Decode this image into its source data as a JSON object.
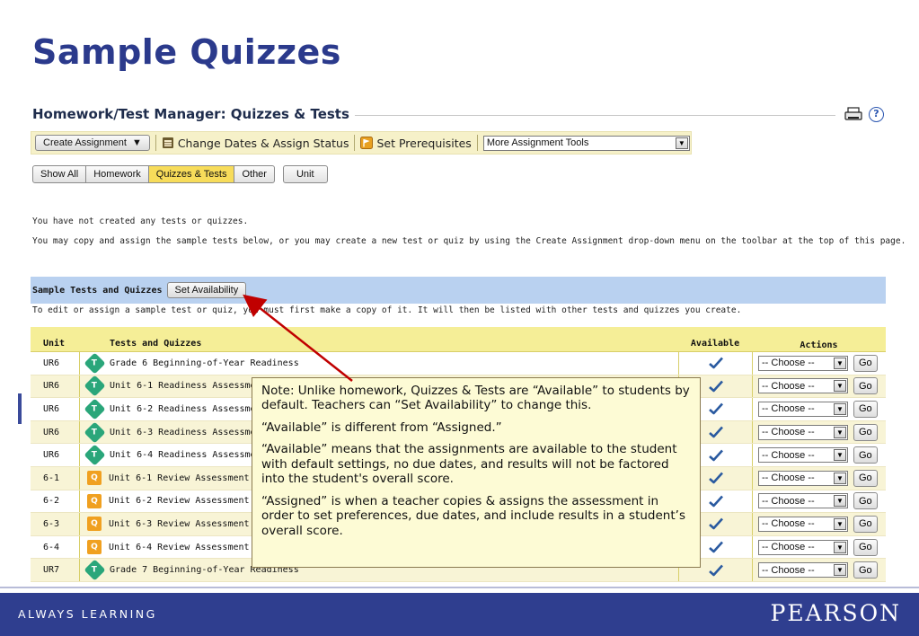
{
  "slide": {
    "title": "Sample Quizzes",
    "footer_left": "ALWAYS LEARNING",
    "footer_right": "PEARSON"
  },
  "manager": {
    "title": "Homework/Test Manager: Quizzes & Tests",
    "help_label": "?"
  },
  "toolbar": {
    "create_assignment": "Create Assignment",
    "change_dates": "Change Dates & Assign Status",
    "set_prerequisites": "Set Prerequisites",
    "more_tools": "More Assignment Tools"
  },
  "filter_tabs": [
    {
      "label": "Show All",
      "active": false
    },
    {
      "label": "Homework",
      "active": false
    },
    {
      "label": "Quizzes & Tests",
      "active": true
    },
    {
      "label": "Other",
      "active": false
    },
    {
      "label": "Unit",
      "active": false
    }
  ],
  "messages": {
    "none_created": "You have not created any tests or quizzes.",
    "may_copy": "You may copy and assign the sample tests below, or you may create a new test or quiz by using the Create Assignment drop-down menu on the toolbar at the top of this page."
  },
  "sample_section": {
    "label": "Sample Tests and Quizzes",
    "set_availability": "Set Availability",
    "instructions": "To edit or assign a sample test or quiz, you must first make a copy of it. It will then be listed with other tests and quizzes you create."
  },
  "table": {
    "headers": {
      "unit": "Unit",
      "name": "Tests and Quizzes",
      "available": "Available",
      "actions": "Actions"
    },
    "choose_label": "-- Choose --",
    "go_label": "Go",
    "rows": [
      {
        "unit": "UR6",
        "type": "T",
        "name": "Grade 6 Beginning-of-Year Readiness"
      },
      {
        "unit": "UR6",
        "type": "T",
        "name": "Unit 6-1 Readiness Assessment"
      },
      {
        "unit": "UR6",
        "type": "T",
        "name": "Unit 6-2 Readiness Assessment"
      },
      {
        "unit": "UR6",
        "type": "T",
        "name": "Unit 6-3 Readiness Assessment"
      },
      {
        "unit": "UR6",
        "type": "T",
        "name": "Unit 6-4 Readiness Assessment"
      },
      {
        "unit": "6-1",
        "type": "Q",
        "name": "Unit 6-1 Review Assessment"
      },
      {
        "unit": "6-2",
        "type": "Q",
        "name": "Unit 6-2 Review Assessment"
      },
      {
        "unit": "6-3",
        "type": "Q",
        "name": "Unit 6-3 Review Assessment"
      },
      {
        "unit": "6-4",
        "type": "Q",
        "name": "Unit 6-4 Review Assessment"
      },
      {
        "unit": "UR7",
        "type": "T",
        "name": "Grade 7 Beginning-of-Year Readiness"
      }
    ]
  },
  "callout": {
    "p1": "Note: Unlike homework, Quizzes & Tests are “Available” to students by default. Teachers can “Set Availability” to change this.",
    "p2": "“Available” is different from “Assigned.”",
    "p3": "“Available” means that the assignments are available to the student with default settings, no due dates, and results will not be factored into the student's overall score.",
    "p4": "“Assigned” is when a teacher copies & assigns the assessment in order to set preferences, due dates, and include results in a student’s overall score."
  },
  "colors": {
    "title": "#2b3a8c",
    "footer": "#2f3e8f",
    "toolbar": "#f6f1c9",
    "sample_bar": "#b9d1f0",
    "active_tab": "#f7dc5a",
    "arrow": "#c00000"
  }
}
